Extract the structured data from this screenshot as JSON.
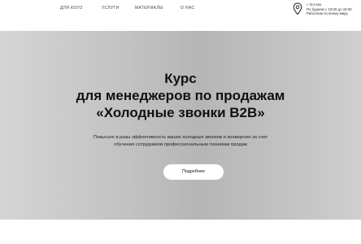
{
  "nav": {
    "items": [
      {
        "label": "ДЛЯ КОГО"
      },
      {
        "label": "УСЛУГИ"
      },
      {
        "label": "МАТЕРИАЛЫ"
      },
      {
        "label": "О НАС"
      }
    ]
  },
  "contact": {
    "city": "г. Москва",
    "hours": "По будням с 10:00 до 18:00",
    "note": "Работаем по всему миру"
  },
  "hero": {
    "title_line1": "Курс",
    "title_line2": "для менеджеров по продажам",
    "title_line3": "«Холодные звонки B2B»",
    "subtitle_line1": "Повысьте в разы эффективность ваших холодных звонков и конверсию за счет",
    "subtitle_line2": "обучения сотрудников профессиональным техникам продаж",
    "cta_label": "Подробнее"
  },
  "colors": {
    "hero_background": "#c0c0c0",
    "button_background": "#ffffff",
    "text": "#111111"
  },
  "icons": {
    "location": "location-pin-icon"
  }
}
